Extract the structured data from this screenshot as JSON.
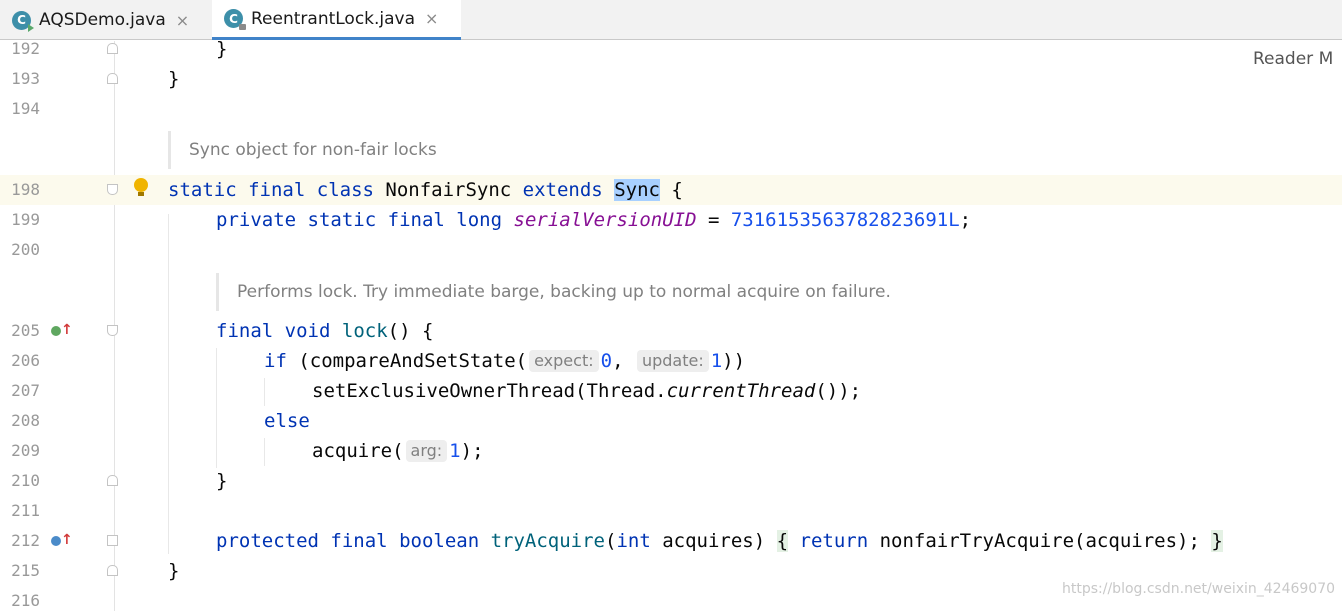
{
  "tabs": [
    {
      "label": "AQSDemo.java",
      "icon": "C",
      "active": false
    },
    {
      "label": "ReentrantLock.java",
      "icon": "C",
      "active": true
    }
  ],
  "tab_close_glyph": "×",
  "reader_mode": "Reader M",
  "docs": {
    "sync_object": "Sync object for non-fair locks",
    "performs_lock": "Performs lock. Try immediate barge, backing up to normal acquire on failure."
  },
  "line_numbers": {
    "l192": "192",
    "l193": "193",
    "l194": "194",
    "l198": "198",
    "l199": "199",
    "l200": "200",
    "l205": "205",
    "l206": "206",
    "l207": "207",
    "l208": "208",
    "l209": "209",
    "l210": "210",
    "l211": "211",
    "l212": "212",
    "l215": "215",
    "l216": "216"
  },
  "code": {
    "l192_brace": "}",
    "l193_brace": "}",
    "l198": {
      "static": "static",
      "final": "final",
      "class": "class",
      "name": " NonfairSync ",
      "extends": "extends",
      "sync": "Sync",
      "open": " {"
    },
    "l199": {
      "private": "private",
      "static": "static",
      "final": "final",
      "long": "long",
      "field": "serialVersionUID",
      "eq": " = ",
      "value": "7316153563782823691L",
      "semi": ";"
    },
    "l205": {
      "final": "final",
      "void": "void",
      "name": "lock",
      "rest": "() {"
    },
    "l206": {
      "if": "if",
      "call": " (compareAndSetState(",
      "hint1": "expect:",
      "v1": "0",
      "comma": ", ",
      "hint2": "update:",
      "v2": "1",
      "close": "))"
    },
    "l207": {
      "call": "setExclusiveOwnerThread(Thread.",
      "method": "currentThread",
      "close": "());"
    },
    "l208": {
      "else": "else"
    },
    "l209": {
      "call": "acquire(",
      "hint": "arg:",
      "v": "1",
      "close": ");"
    },
    "l210_brace": "}",
    "l212": {
      "protected": "protected",
      "final": "final",
      "boolean": "boolean",
      "name": "tryAcquire",
      "open_paren": "(",
      "int": "int",
      "param": " acquires)",
      "brace_open": "{",
      "return": "return",
      "body": " nonfairTryAcquire(acquires); ",
      "brace_close": "}"
    },
    "l215_brace": "}"
  },
  "watermark": "https://blog.csdn.net/weixin_42469070"
}
